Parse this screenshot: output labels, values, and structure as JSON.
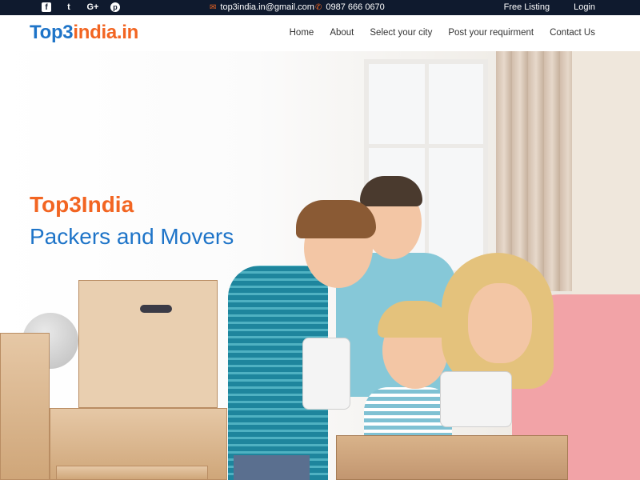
{
  "topbar": {
    "social": [
      {
        "icon": "facebook-icon",
        "glyph": "f"
      },
      {
        "icon": "twitter-icon",
        "glyph": "t"
      },
      {
        "icon": "google-plus-icon",
        "glyph": "G+"
      },
      {
        "icon": "pinterest-icon",
        "glyph": "p"
      }
    ],
    "email": "top3india.in@gmail.com",
    "phone": "0987 666 0670",
    "links": [
      "Free Listing",
      "Login"
    ]
  },
  "header": {
    "logo_main": "Top3",
    "logo_rest": "india.in",
    "nav": [
      "Home",
      "About",
      "Select your city",
      "Post your requirment",
      "Contact Us"
    ]
  },
  "hero": {
    "title": "Top3India",
    "subtitle": "Packers and Movers"
  },
  "colors": {
    "accent_orange": "#f26522",
    "brand_blue": "#1e74c8",
    "topbar_bg": "#0f1a2e"
  }
}
